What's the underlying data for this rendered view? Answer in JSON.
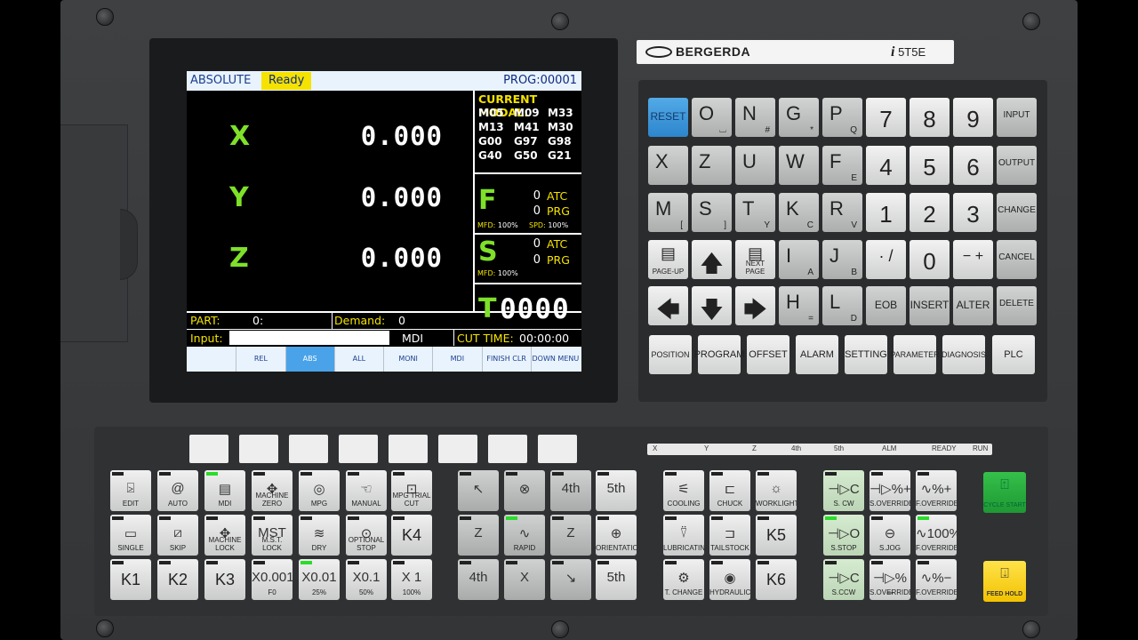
{
  "screen": {
    "mode": "ABSOLUTE",
    "status": "Ready",
    "program": "PROG:00001",
    "axes": [
      {
        "label": "X",
        "value": "0.000"
      },
      {
        "label": "Y",
        "value": "0.000"
      },
      {
        "label": "Z",
        "value": "0.000"
      }
    ],
    "modal_title": "CURRENT MODAL:",
    "modal_codes": [
      "M05",
      "M09",
      "M33",
      "M13",
      "M41",
      "M30",
      "G00",
      "G97",
      "G98",
      "G40",
      "G50",
      "G21"
    ],
    "feed": {
      "letter": "F",
      "atc_val": "0",
      "atc": "ATC",
      "prg_val": "0",
      "prg": "PRG",
      "mfd_label": "MFD:",
      "mfd": "100%",
      "spd_label": "SPD:",
      "spd": "100%"
    },
    "spindle": {
      "letter": "S",
      "atc_val": "0",
      "atc": "ATC",
      "prg_val": "0",
      "prg": "PRG",
      "mfd_label": "MFD:",
      "mfd": "100%"
    },
    "tool": {
      "letter": "T",
      "value": "0000"
    },
    "part_label": "PART:",
    "part_value": "0:",
    "demand_label": "Demand:",
    "demand_value": "0",
    "input_label": "Input:",
    "input_value": "",
    "input_mode": "MDI",
    "cut_time_label": "CUT TIME:",
    "cut_time": "00:00:00",
    "softkeys": [
      {
        "label": "",
        "active": false
      },
      {
        "label": "REL",
        "active": false
      },
      {
        "label": "ABS",
        "active": true
      },
      {
        "label": "ALL",
        "active": false
      },
      {
        "label": "MONI",
        "active": false
      },
      {
        "label": "MDI",
        "active": false
      },
      {
        "label": "FINISH CLR",
        "active": false
      },
      {
        "label": "DOWN MENU",
        "active": false
      }
    ]
  },
  "brand": {
    "name": "BERGERDA",
    "model_prefix": "i",
    "model": "5T5E"
  },
  "keypad": {
    "reset": "RESET",
    "letters": [
      {
        "main": "O",
        "sub": "⌴"
      },
      {
        "main": "N",
        "sub": "#"
      },
      {
        "main": "G",
        "sub": "*"
      },
      {
        "main": "P",
        "sub": "Q"
      },
      {
        "main": "X",
        "sub": ""
      },
      {
        "main": "Z",
        "sub": ""
      },
      {
        "main": "U",
        "sub": ""
      },
      {
        "main": "W",
        "sub": ""
      },
      {
        "main": "F",
        "sub": "E"
      },
      {
        "main": "M",
        "sub": "["
      },
      {
        "main": "S",
        "sub": "]"
      },
      {
        "main": "T",
        "sub": "Y"
      },
      {
        "main": "K",
        "sub": "C"
      },
      {
        "main": "R",
        "sub": "V"
      },
      {
        "main": "I",
        "sub": "A"
      },
      {
        "main": "J",
        "sub": "B"
      },
      {
        "main": "H",
        "sub": "="
      },
      {
        "main": "L",
        "sub": "D"
      }
    ],
    "digits": [
      "7",
      "8",
      "9",
      "4",
      "5",
      "6",
      "1",
      "2",
      "3"
    ],
    "zero": "0",
    "dot": "· /",
    "minus": "− +",
    "edit_keys": [
      "INPUT",
      "OUTPUT",
      "CHANGE",
      "CANCEL",
      "DELETE"
    ],
    "page_up": "PAGE-UP",
    "next_page": "NEXT PAGE",
    "eob": "EOB",
    "insert": "INSERT",
    "alter": "ALTER",
    "function_keys": [
      "POSITION",
      "PROGRAM",
      "OFFSET",
      "ALARM",
      "SETTING",
      "PARAMETER",
      "DIAGNOSIS",
      "PLC"
    ]
  },
  "leds": [
    "X",
    "Y",
    "Z",
    "4th",
    "5th",
    "ALM",
    "READY",
    "RUN"
  ],
  "mode_keys": [
    {
      "label": "EDIT",
      "icon": "⍄"
    },
    {
      "label": "AUTO",
      "icon": "@"
    },
    {
      "label": "MDI",
      "icon": "▤"
    },
    {
      "label": "MACHINE ZERO",
      "icon": "✥"
    },
    {
      "label": "MPG",
      "icon": "◎"
    },
    {
      "label": "MANUAL",
      "icon": "☜"
    },
    {
      "label": "MPG TRIAL CUT",
      "icon": "⊡"
    },
    {
      "label": "SINGLE",
      "icon": "▭"
    },
    {
      "label": "SKIP",
      "icon": "⧄"
    },
    {
      "label": "MACHINE LOCK",
      "icon": "✥"
    },
    {
      "label": "M.S.T. LOCK",
      "icon": "MST"
    },
    {
      "label": "DRY",
      "icon": "≋"
    },
    {
      "label": "OPTIONAL STOP",
      "icon": "⊙"
    },
    {
      "label": "K4",
      "icon": ""
    },
    {
      "label": "K1",
      "icon": ""
    },
    {
      "label": "K2",
      "icon": ""
    },
    {
      "label": "K3",
      "icon": ""
    },
    {
      "label": "F0",
      "icon": "X0.001"
    },
    {
      "label": "25%",
      "icon": "X0.01"
    },
    {
      "label": "50%",
      "icon": "X0.1"
    },
    {
      "label": "100%",
      "icon": "X 1"
    }
  ],
  "jog_keys": [
    {
      "label": "",
      "icon": "↖"
    },
    {
      "label": "",
      "icon": "⊗"
    },
    {
      "label": "",
      "icon": "4th"
    },
    {
      "label": "",
      "icon": "5th"
    },
    {
      "label": "",
      "icon": "Z"
    },
    {
      "label": "RAPID",
      "icon": "∿"
    },
    {
      "label": "",
      "icon": "Z"
    },
    {
      "label": "ORIENTATION",
      "icon": "⊕"
    },
    {
      "label": "",
      "icon": "4th"
    },
    {
      "label": "",
      "icon": "X"
    },
    {
      "label": "",
      "icon": "↘"
    },
    {
      "label": "",
      "icon": "5th"
    }
  ],
  "aux_keys": [
    {
      "label": "COOLING",
      "icon": "⚟"
    },
    {
      "label": "CHUCK",
      "icon": "⊏"
    },
    {
      "label": "WORKLIGHT",
      "icon": "☼"
    },
    {
      "label": "LUBRICATING",
      "icon": "⍢"
    },
    {
      "label": "TAILSTOCK",
      "icon": "⊐"
    },
    {
      "label": "K5",
      "icon": ""
    },
    {
      "label": "T. CHANGE",
      "icon": "⚙"
    },
    {
      "label": "HYDRAULIC",
      "icon": "◉"
    },
    {
      "label": "K6",
      "icon": ""
    }
  ],
  "spindle_keys": [
    {
      "label": "S. CW",
      "icon": "⊣▷C"
    },
    {
      "label": "S.OVERRIDE",
      "icon": "⊣▷%+"
    },
    {
      "label": "F.OVERRIDE",
      "icon": "∿%+"
    },
    {
      "label": "S.STOP",
      "icon": "⊣▷O"
    },
    {
      "label": "S.JOG",
      "icon": "⊖"
    },
    {
      "label": "F.OVERRIDE",
      "icon": "∿100%"
    },
    {
      "label": "S.CCW",
      "icon": "⊣▷C"
    },
    {
      "label": "S.OVERRIDE",
      "icon": "⊣▷%−"
    },
    {
      "label": "F.OVERRIDE",
      "icon": "∿%−"
    }
  ],
  "cycle_start": "CYCLE START",
  "feed_hold": "FEED HOLD"
}
